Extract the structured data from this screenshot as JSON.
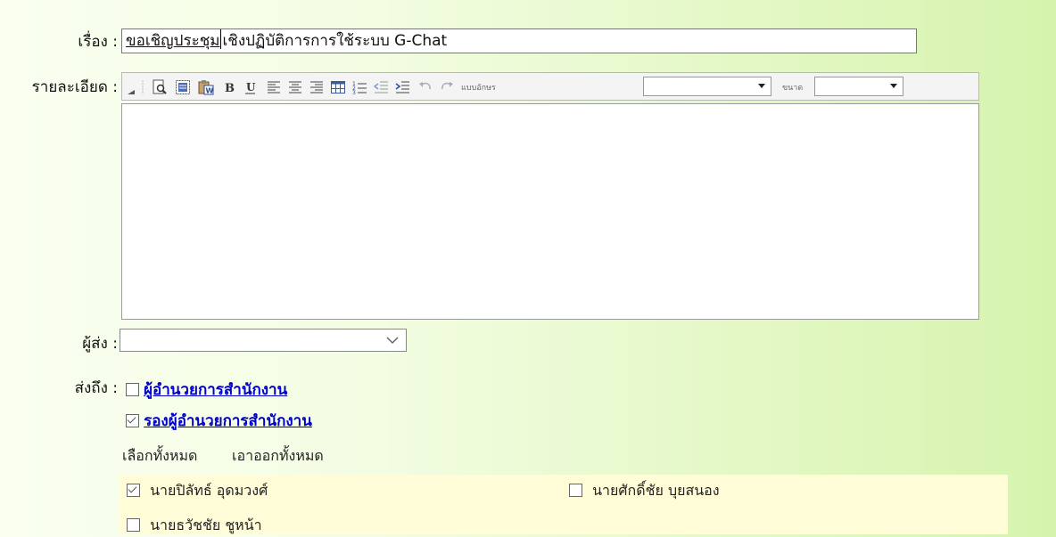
{
  "form": {
    "subject_label": "เรื่อง :",
    "subject_part1": "ขอเชิญ",
    "subject_part2": "ประชุม",
    "subject_part3": "เชิงปฏิบัติการการใช้ระบบ G-Chat",
    "detail_label": "รายละเอียด :",
    "sender_label": "ผู้ส่ง :",
    "sender_value": "",
    "recipient_label": "ส่งถึง :"
  },
  "toolbar": {
    "font_label": "แบบอักษร",
    "size_label": "ขนาด",
    "font_value": "",
    "size_value": ""
  },
  "groups": [
    {
      "label": "ผู้อำนวยการสำนักงาน",
      "checked": false
    },
    {
      "label": "รองผู้อำนวยการสำนักงาน",
      "checked": true
    }
  ],
  "select_all": "เลือกทั้งหมด",
  "deselect_all": "เอาออกทั้งหมด",
  "people": [
    {
      "name": "นายปิลัทธ์ อุดมวงศ์",
      "checked": true
    },
    {
      "name": "นายศักดิ์ชัย บุยสนอง",
      "checked": false
    },
    {
      "name": "นายธวัชชัย ชูหน้า",
      "checked": false
    }
  ]
}
